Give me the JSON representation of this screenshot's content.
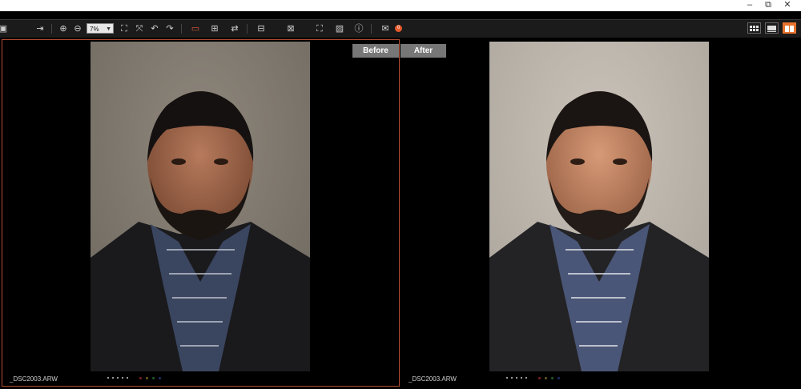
{
  "window": {
    "minimize_label": "–",
    "restore_label": "⧉",
    "close_label": "✕"
  },
  "toolbar": {
    "zoom_value": "7%",
    "notification_count": "0",
    "icons": [
      "export-icon",
      "zoom-in-icon",
      "zoom-out-icon",
      "fit-icon",
      "actual-size-icon",
      "rotate-left-icon",
      "rotate-right-icon",
      "compare-side-by-side-icon",
      "compare-split-icon",
      "compare-swap-icon",
      "layout-icon",
      "grid-icon",
      "fullscreen-icon",
      "image-icon",
      "info-icon",
      "mail-icon"
    ]
  },
  "compare": {
    "before_label": "Before",
    "after_label": "After"
  },
  "panes": [
    {
      "filename": "_DSC2003.ARW",
      "selected": true
    },
    {
      "filename": "_DSC2003.ARW",
      "selected": false
    }
  ],
  "view_modes": [
    "grid-view-icon",
    "single-view-icon",
    "compare-view-icon"
  ],
  "colors": {
    "accent": "#e8722c",
    "selection": "#b34a33",
    "toolbar_bg": "#1b1b1b"
  }
}
